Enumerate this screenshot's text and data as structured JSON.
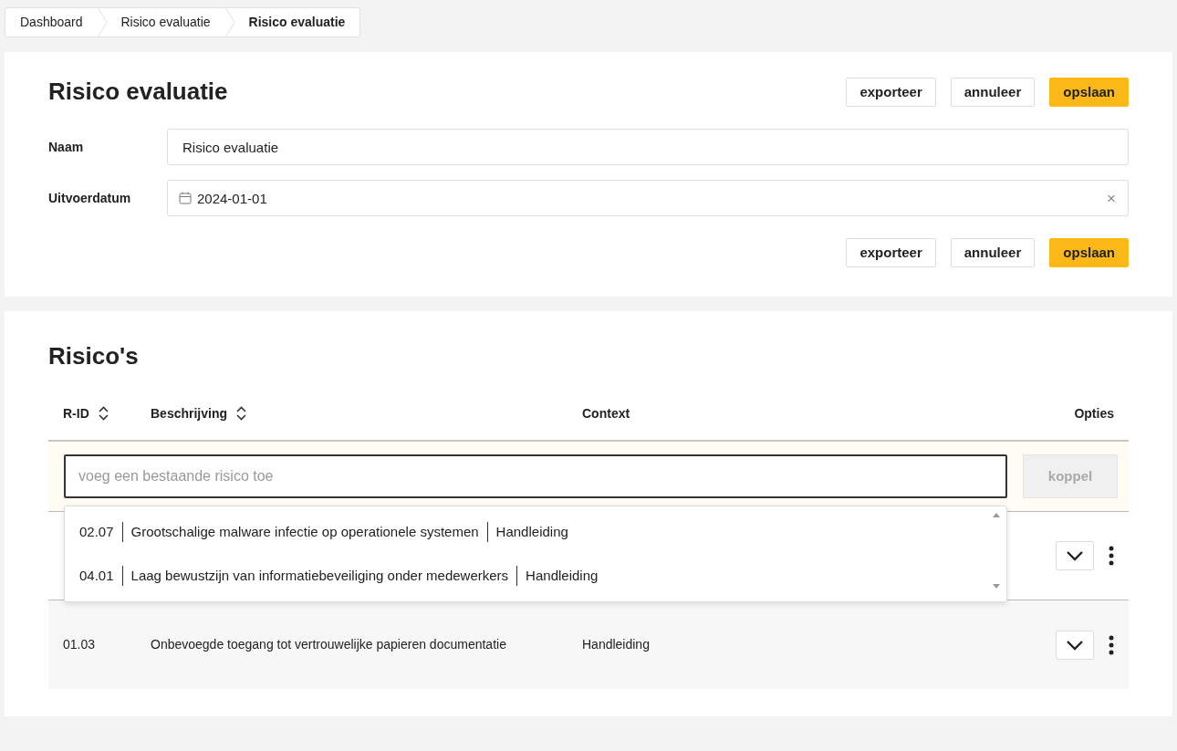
{
  "breadcrumb": [
    {
      "label": "Dashboard",
      "current": false
    },
    {
      "label": "Risico evaluatie",
      "current": false
    },
    {
      "label": "Risico evaluatie",
      "current": true
    }
  ],
  "evaluation": {
    "title": "Risico evaluatie",
    "buttons": [
      {
        "label": "exporteer",
        "kind": "plain"
      },
      {
        "label": "annuleer",
        "kind": "plain"
      },
      {
        "label": "opslaan",
        "kind": "primary"
      }
    ],
    "footer_buttons": [
      {
        "label": "exporteer",
        "kind": "plain"
      },
      {
        "label": "annuleer",
        "kind": "plain"
      },
      {
        "label": "opslaan",
        "kind": "primary"
      }
    ],
    "fields": [
      {
        "label": "Naam",
        "value": "Risico evaluatie",
        "kind": "text"
      },
      {
        "label": "Uitvoerdatum",
        "value": "2024-01-01",
        "kind": "date",
        "clear": "×"
      }
    ]
  },
  "risks": {
    "title": "Risico's",
    "columns": [
      {
        "label": "R-ID",
        "sortable": true
      },
      {
        "label": "Beschrijving",
        "sortable": true
      },
      {
        "label": "Context",
        "sortable": false
      },
      {
        "label": "Opties",
        "sortable": false
      }
    ],
    "add": {
      "placeholder": "voeg een bestaande risico toe",
      "button": "koppel",
      "disabled": true
    },
    "suggestions": [
      {
        "id": "02.07",
        "description": "Grootschalige malware infectie op operationele systemen",
        "context": "Handleiding"
      },
      {
        "id": "04.01",
        "description": "Laag bewustzijn van informatiebeveiliging onder medewerkers",
        "context": "Handleiding"
      }
    ],
    "rows": [
      {},
      {
        "id": "01.03",
        "description": "Onbevoegde toegang tot vertrouwelijke papieren documentatie",
        "context": "Handleiding"
      }
    ]
  }
}
